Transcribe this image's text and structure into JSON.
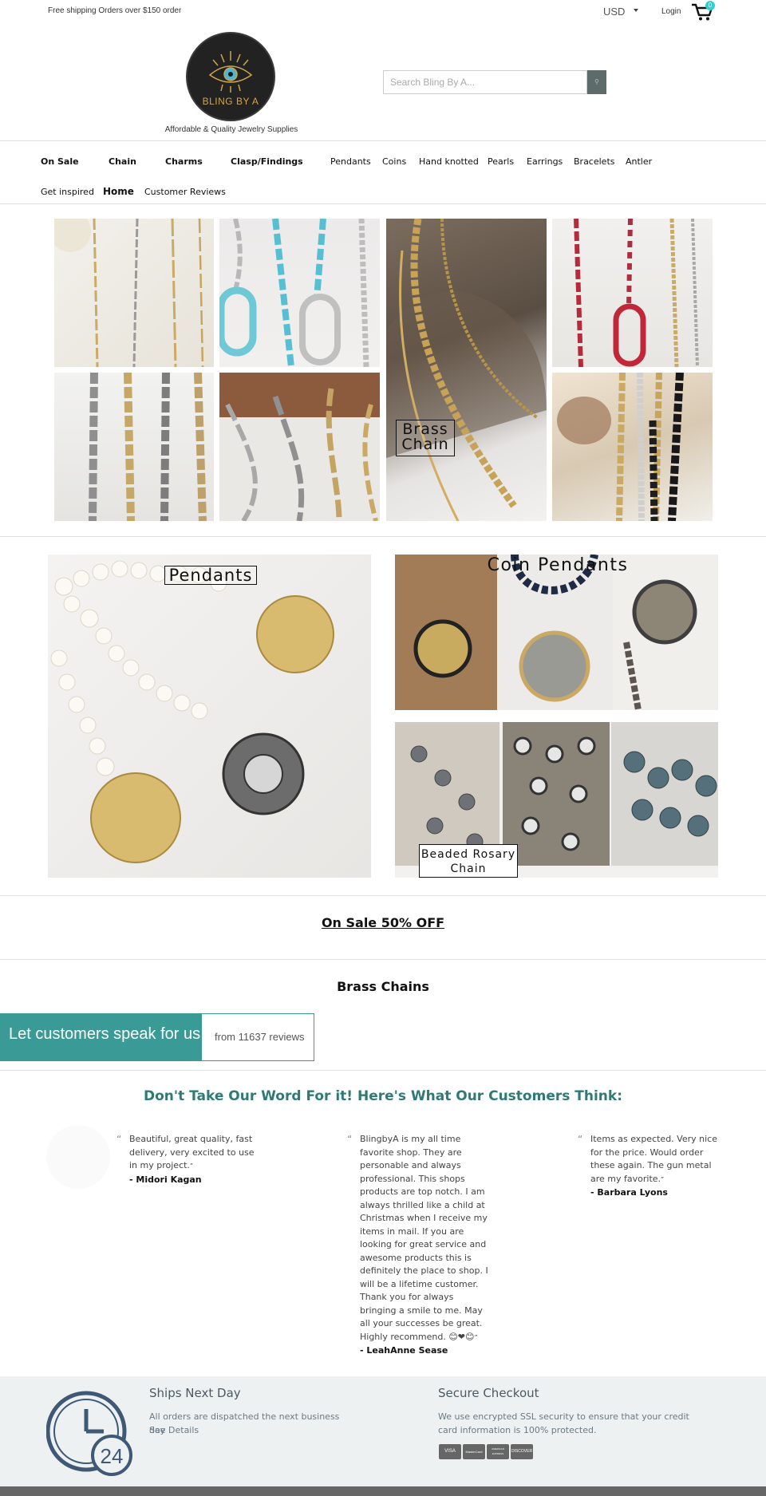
{
  "topbar": {
    "promo": "Free shipping Orders over $150 order",
    "currency": "USD",
    "login": "Login",
    "cart_count": "0"
  },
  "header": {
    "logo_text": "BLING BY A",
    "tagline": "Affordable & Quality Jewelry Supplies",
    "search_placeholder": "Search Bling By A..."
  },
  "nav": {
    "row1": [
      "On Sale",
      "Chain",
      "Charms",
      "Clasp/Findings",
      "Pendants",
      "Coins",
      "Hand knotted",
      "Pearls",
      "Earrings",
      "Bracelets",
      "Antler"
    ],
    "row2": [
      "Get inspired",
      "Home",
      "Customer Reviews"
    ]
  },
  "grid": {
    "brass_label_1": "Brass",
    "brass_label_2": "Chain"
  },
  "features": {
    "pendants": "Pendants",
    "coin_pendants": "Coin Pendants",
    "rosary_1": "Beaded Rosary",
    "rosary_2": "Chain"
  },
  "sections": {
    "on_sale": "On Sale 50% OFF",
    "brass_chains": "Brass Chains"
  },
  "speak": {
    "title": "Let customers speak for us",
    "count": "from 11637 reviews"
  },
  "reviews": {
    "heading": "Don't Take Our Word For it! Here's What Our Customers Think:",
    "items": [
      {
        "text": "Beautiful, great quality, fast delivery, very excited to use in my project.",
        "author": "- Midori Kagan"
      },
      {
        "text": "BlingbyA is my all time favorite shop. They are personable and always professional. This shops products are top notch. I am always thrilled like a child at Christmas when I receive my items in mail. If you are looking for great service and awesome products this is definitely the place to shop. I will be a lifetime customer. Thank you for always bringing a smile to me. May all your successes be great. Highly recommend. 😊❤😊",
        "author": "- LeahAnne Sease"
      },
      {
        "text": "Items as expected. Very nice for the price. Would order these again. The gun metal are my favorite.",
        "author": "- Barbara Lyons"
      }
    ]
  },
  "footer": {
    "ship_title": "Ships Next Day",
    "ship_text": "All orders are dispatched the next business day",
    "ship_link": "See Details",
    "secure_title": "Secure Checkout",
    "secure_text": "We use encrypted SSL security to ensure that your credit card information is 100% protected.",
    "cards": [
      "VISA",
      "MasterCard",
      "AMERICAN EXPRESS",
      "DISCOVER"
    ],
    "clock_number": "24"
  },
  "colors": {
    "accent": "#3a9a95",
    "heading_teal": "#2e7a76",
    "cart_badge": "#2fd0cf",
    "footer_bg": "#eef1f2"
  }
}
